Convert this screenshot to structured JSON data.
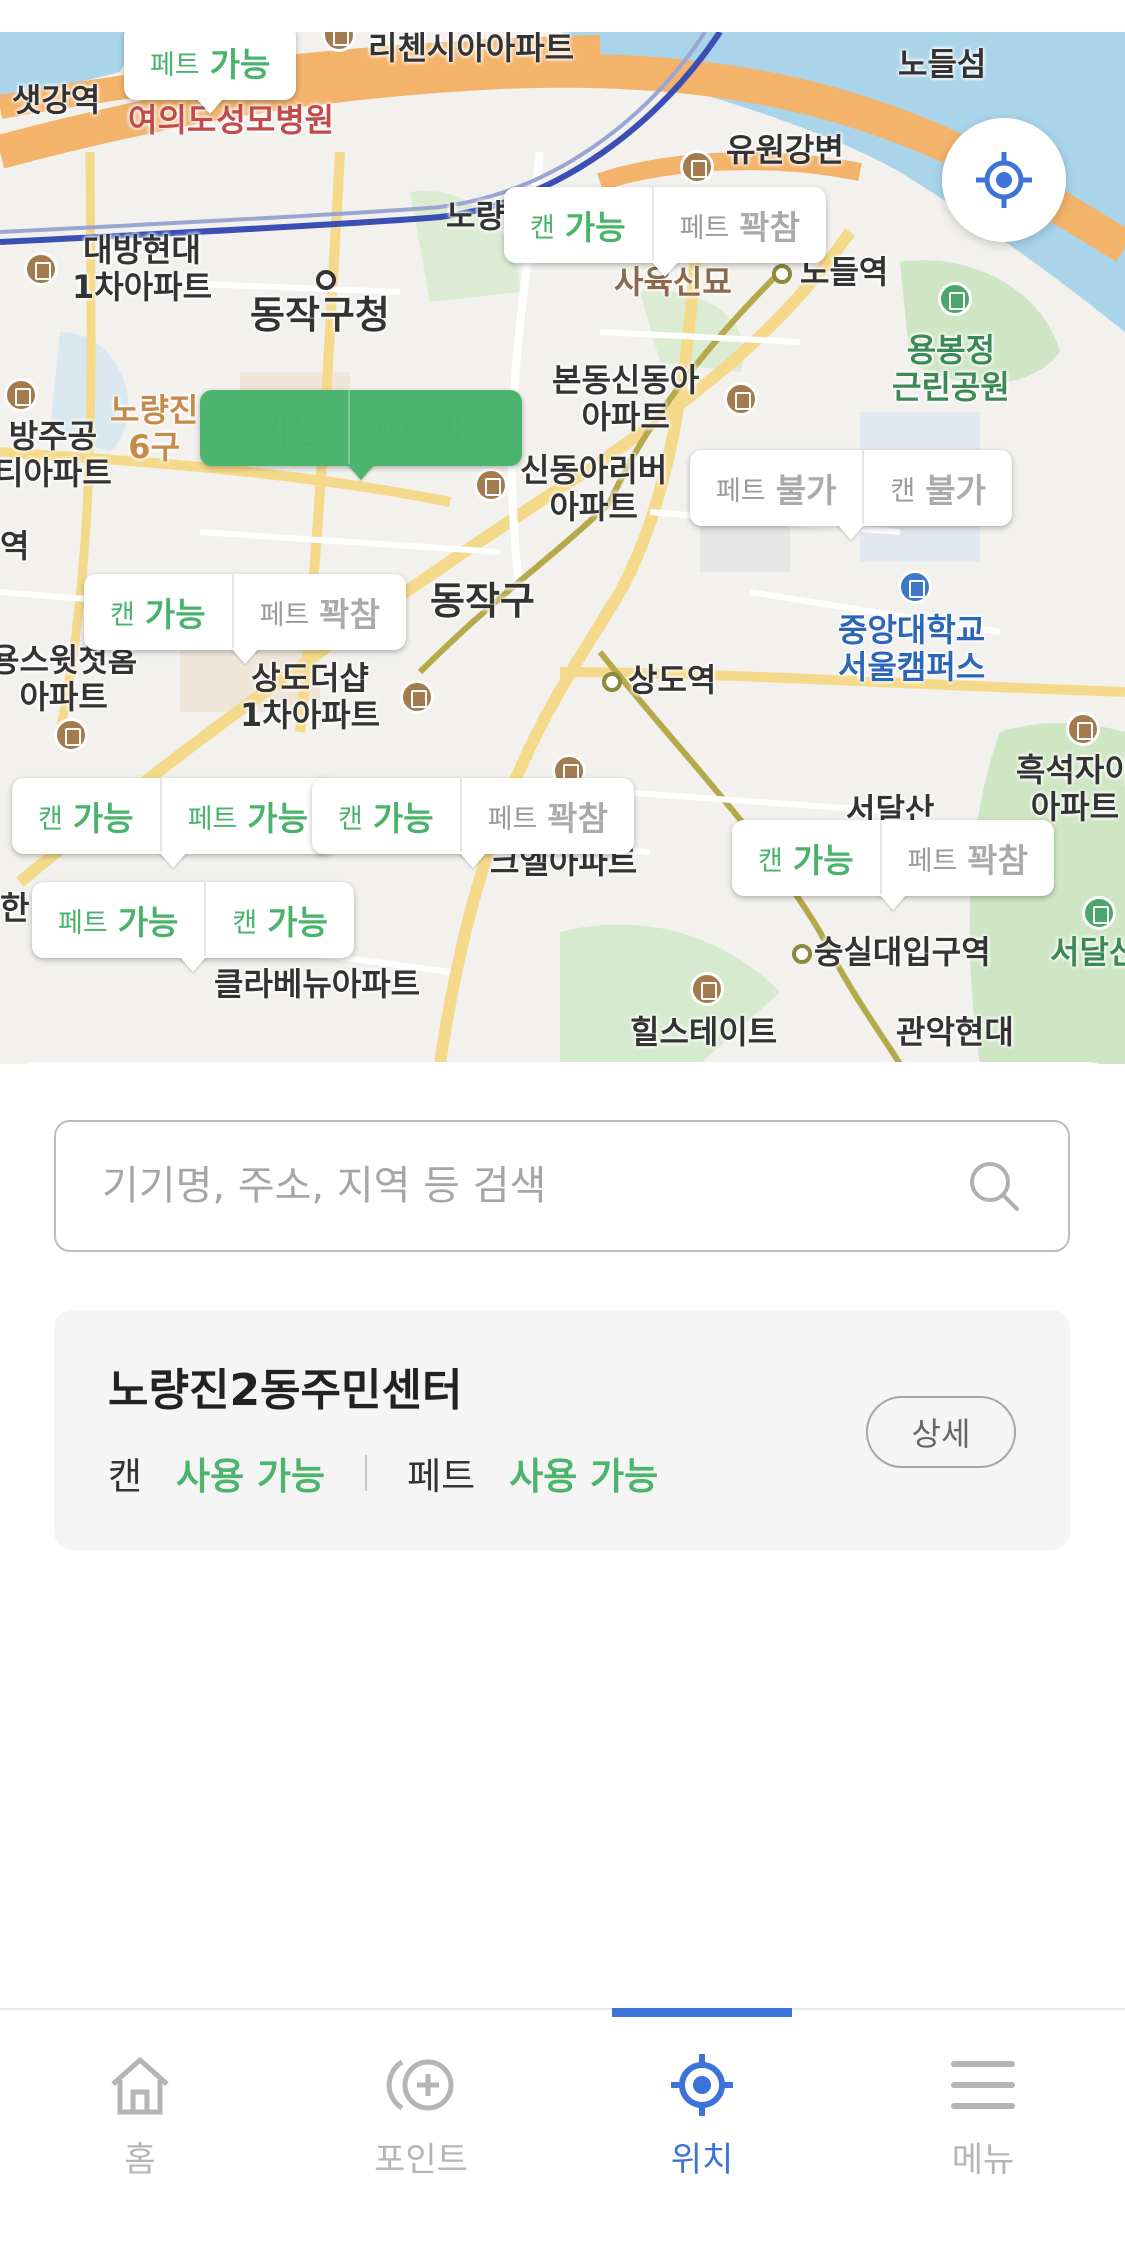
{
  "map": {
    "labels": [
      {
        "text": "리첸시아아파트",
        "cls": ""
      },
      {
        "text": "샛강역",
        "cls": ""
      },
      {
        "text": "여의도성모병원",
        "cls": "red"
      },
      {
        "text": "유원강변",
        "cls": ""
      },
      {
        "text": "노들섬",
        "cls": ""
      },
      {
        "text": "대방현대\n1차아파트",
        "cls": "multi"
      },
      {
        "text": "동작구청",
        "cls": "big"
      },
      {
        "text": "사육신묘",
        "cls": ""
      },
      {
        "text": "노들역",
        "cls": ""
      },
      {
        "text": "용봉정\n근린공원",
        "cls": "green multi"
      },
      {
        "text": "본동신동아\n아파트",
        "cls": "multi"
      },
      {
        "text": "노량진\n6구",
        "cls": "multi"
      },
      {
        "text": "방주공\n티아파트",
        "cls": "multi"
      },
      {
        "text": "신동아리버\n아파트",
        "cls": "multi"
      },
      {
        "text": "동작구",
        "cls": "big"
      },
      {
        "text": "중앙대학교\n서울캠퍼스",
        "cls": "blue multi"
      },
      {
        "text": "상도역",
        "cls": ""
      },
      {
        "text": "용스윗첫홈\n아파트",
        "cls": "multi"
      },
      {
        "text": "상도더샵\n1차아파트",
        "cls": "multi"
      },
      {
        "text": "흑석자이\n아파트",
        "cls": "multi"
      },
      {
        "text": "서달산",
        "cls": ""
      },
      {
        "text": "크엘아파트",
        "cls": ""
      },
      {
        "text": "숭실대입구역",
        "cls": ""
      },
      {
        "text": "서달산",
        "cls": "green"
      },
      {
        "text": "클라베뉴아파트",
        "cls": ""
      },
      {
        "text": "힐스테이트",
        "cls": ""
      },
      {
        "text": "관악현대",
        "cls": ""
      },
      {
        "text": "역",
        "cls": ""
      },
      {
        "text": "한",
        "cls": ""
      },
      {
        "text": "노량",
        "cls": ""
      }
    ],
    "markers": [
      {
        "selected": false,
        "segs": [
          {
            "k": "페트",
            "v": "가능",
            "ok": true
          }
        ]
      },
      {
        "selected": false,
        "segs": [
          {
            "k": "캔",
            "v": "가능",
            "ok": true
          },
          {
            "k": "페트",
            "v": "꽉참",
            "ok": false
          }
        ]
      },
      {
        "selected": true,
        "segs": [
          {
            "k": "캔",
            "v": "가능",
            "ok": true
          },
          {
            "k": "페트",
            "v": "가능",
            "ok": true
          }
        ]
      },
      {
        "selected": false,
        "segs": [
          {
            "k": "페트",
            "v": "불가",
            "ok": false
          },
          {
            "k": "캔",
            "v": "불가",
            "ok": false
          }
        ]
      },
      {
        "selected": false,
        "segs": [
          {
            "k": "캔",
            "v": "가능",
            "ok": true
          },
          {
            "k": "페트",
            "v": "꽉참",
            "ok": false
          }
        ]
      },
      {
        "selected": false,
        "segs": [
          {
            "k": "캔",
            "v": "가능",
            "ok": true
          },
          {
            "k": "페트",
            "v": "가능",
            "ok": true
          }
        ]
      },
      {
        "selected": false,
        "segs": [
          {
            "k": "캔",
            "v": "가능",
            "ok": true
          },
          {
            "k": "페트",
            "v": "꽉참",
            "ok": false
          }
        ]
      },
      {
        "selected": false,
        "segs": [
          {
            "k": "캔",
            "v": "가능",
            "ok": true
          },
          {
            "k": "페트",
            "v": "꽉참",
            "ok": false
          }
        ]
      },
      {
        "selected": false,
        "segs": [
          {
            "k": "페트",
            "v": "가능",
            "ok": true
          },
          {
            "k": "캔",
            "v": "가능",
            "ok": true
          }
        ]
      }
    ],
    "locate_button_icon": "crosshair-locate-icon"
  },
  "search": {
    "placeholder": "기기명, 주소, 지역 등 검색",
    "value": "",
    "icon": "search-icon"
  },
  "selected_location": {
    "name": "노량진2동주민센터",
    "can_label": "캔",
    "can_status": "사용 가능",
    "pet_label": "페트",
    "pet_status": "사용 가능",
    "detail_button": "상세"
  },
  "tabbar": {
    "active_index": 2,
    "items": [
      {
        "label": "홈",
        "icon": "home-icon"
      },
      {
        "label": "포인트",
        "icon": "points-icon"
      },
      {
        "label": "위치",
        "icon": "location-icon"
      },
      {
        "label": "메뉴",
        "icon": "menu-icon"
      }
    ]
  },
  "colors": {
    "accent_blue": "#3c73d8",
    "status_green": "#4cb46d",
    "inactive_gray": "#b5b5b5"
  }
}
